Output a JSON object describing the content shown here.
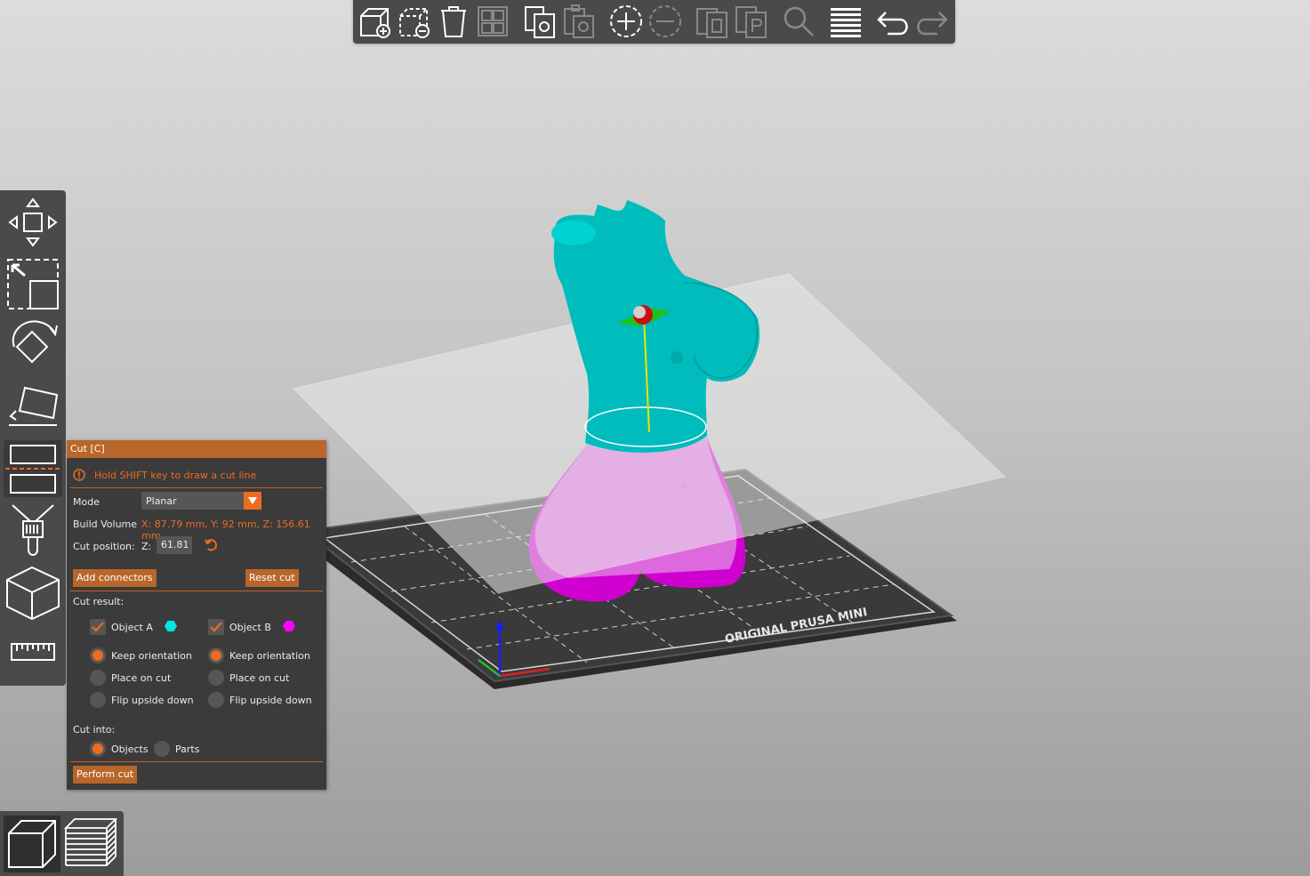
{
  "top_toolbar": {
    "buttons": [
      {
        "name": "add",
        "icon": "add-object-icon",
        "enabled": true
      },
      {
        "name": "delete",
        "icon": "delete-object-icon",
        "enabled": true
      },
      {
        "name": "delete-all",
        "icon": "trash-icon",
        "enabled": true
      },
      {
        "name": "arrange",
        "icon": "arrange-icon",
        "enabled": false
      },
      {
        "name": "copy",
        "icon": "copy-icon",
        "enabled": true
      },
      {
        "name": "paste",
        "icon": "paste-icon",
        "enabled": false
      },
      {
        "name": "add-instance",
        "icon": "plus-circle-icon",
        "enabled": true
      },
      {
        "name": "remove-instance",
        "icon": "minus-circle-icon",
        "enabled": false
      },
      {
        "name": "split-objects",
        "icon": "split-objects-icon",
        "enabled": false
      },
      {
        "name": "split-parts",
        "icon": "split-parts-icon",
        "enabled": false
      },
      {
        "name": "search",
        "icon": "search-icon",
        "enabled": false
      },
      {
        "name": "layers-editing",
        "icon": "layers-icon",
        "enabled": true
      },
      {
        "name": "undo",
        "icon": "undo-icon",
        "enabled": true
      },
      {
        "name": "redo",
        "icon": "redo-icon",
        "enabled": false
      }
    ]
  },
  "left_toolbar": {
    "tools": [
      {
        "name": "move",
        "icon": "move-icon"
      },
      {
        "name": "scale",
        "icon": "scale-icon"
      },
      {
        "name": "rotate",
        "icon": "rotate-icon"
      },
      {
        "name": "place-on-face",
        "icon": "place-on-face-icon"
      },
      {
        "name": "cut",
        "icon": "cut-icon",
        "active": true
      },
      {
        "name": "paint-supports",
        "icon": "paint-brush-icon"
      },
      {
        "name": "seam-painting",
        "icon": "cube-icon"
      },
      {
        "name": "measure",
        "icon": "ruler-icon"
      }
    ]
  },
  "cut_panel": {
    "title": "Cut [C]",
    "hint": "Hold SHIFT key to draw a cut line",
    "mode_label": "Mode",
    "mode_value": "Planar",
    "build_volume_label": "Build Volume",
    "build_volume_value": "X: 87.79 mm,  Y: 92 mm,  Z: 156.61 mm",
    "cut_position_label": "Cut position:",
    "z_label": "Z:",
    "z_value": "61.81",
    "add_connectors": "Add connectors",
    "reset_cut": "Reset cut",
    "cut_result_label": "Cut result:",
    "object_a": {
      "label": "Object A",
      "checked": true,
      "color": "#00e0e0",
      "options": [
        "Keep orientation",
        "Place on cut",
        "Flip upside down"
      ],
      "selected": 0
    },
    "object_b": {
      "label": "Object B",
      "checked": true,
      "color": "#ff00ff",
      "options": [
        "Keep orientation",
        "Place on cut",
        "Flip upside down"
      ],
      "selected": 0
    },
    "cut_into_label": "Cut into:",
    "cut_into_options": [
      "Objects",
      "Parts"
    ],
    "cut_into_selected": 0,
    "perform_cut": "Perform cut"
  },
  "bed": {
    "label": "ORIGINAL PRUSA MINI"
  },
  "view_toolbar": {
    "views": [
      {
        "name": "3d-view",
        "icon": "cube-view-icon",
        "active": true
      },
      {
        "name": "preview",
        "icon": "layers-preview-icon",
        "active": false
      }
    ]
  },
  "colors": {
    "accent": "#ed6b21",
    "object_a": "#00bfbf",
    "object_b": "#e000e0",
    "panel_bg": "#3b3b3b",
    "toolbar_bg": "#4a4a4a"
  }
}
